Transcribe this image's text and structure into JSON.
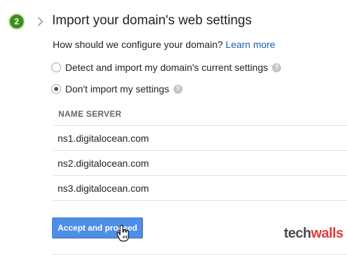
{
  "step": {
    "number": "2",
    "title": "Import your domain's web settings"
  },
  "question": {
    "text": "How should we configure your domain?",
    "link": "Learn more"
  },
  "options": [
    {
      "label": "Detect and import my domain's current settings",
      "selected": false
    },
    {
      "label": "Don't import my settings",
      "selected": true
    }
  ],
  "name_servers": {
    "header": "NAME SERVER",
    "rows": [
      "ns1.digitalocean.com",
      "ns2.digitalocean.com",
      "ns3.digitalocean.com"
    ]
  },
  "actions": {
    "accept_label": "Accept and proceed"
  },
  "watermark": {
    "tech": "tech",
    "walls": "walls"
  },
  "colors": {
    "accent": "#4d8ee8",
    "step_badge": "#3c8f1e",
    "link": "#1a5fb4"
  }
}
